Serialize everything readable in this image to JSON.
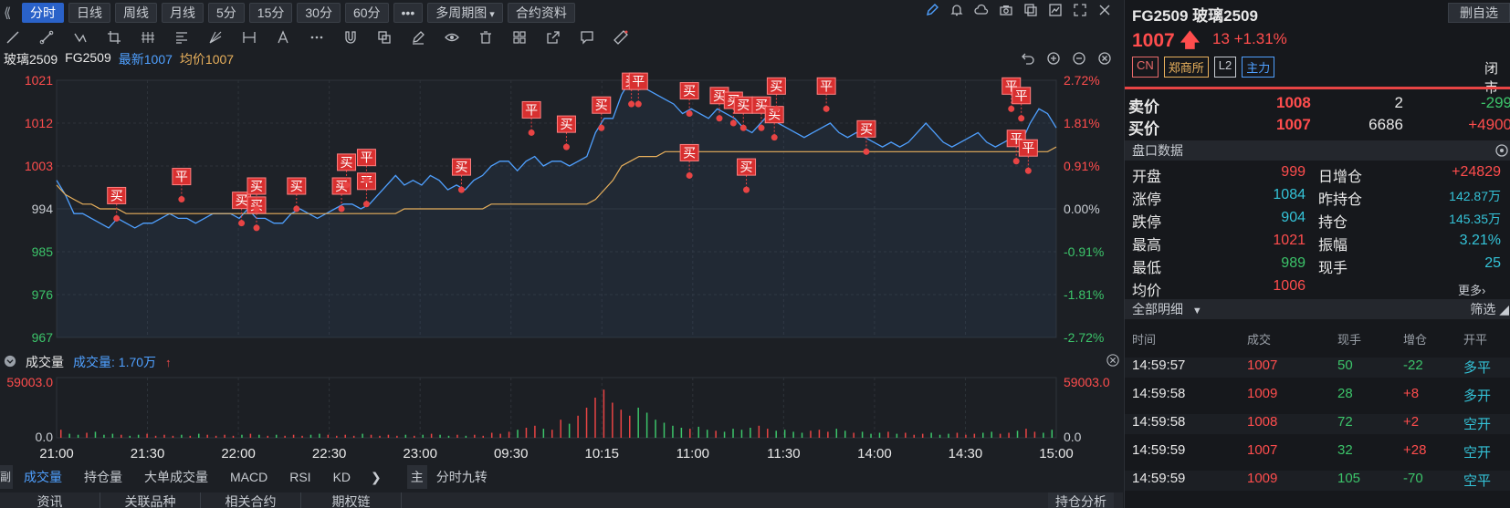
{
  "toolbar": {
    "periods": [
      "分时",
      "日线",
      "周线",
      "月线",
      "5分",
      "15分",
      "30分",
      "60分"
    ],
    "more": "•••",
    "multi": "多周期图",
    "contract": "合约资料"
  },
  "info": {
    "name": "玻璃2509",
    "code": "FG2509",
    "latest": "最新1007",
    "avg": "均价1007"
  },
  "chart_data": {
    "type": "line",
    "x_ticks": [
      "21:00",
      "21:30",
      "22:00",
      "22:30",
      "23:00",
      "09:30",
      "10:15",
      "11:00",
      "11:30",
      "14:00",
      "14:30",
      "15:00"
    ],
    "y_left_ticks": [
      "1021",
      "1012",
      "1003",
      "994",
      "985",
      "976",
      "967"
    ],
    "y_right_ticks": [
      "2.72%",
      "1.81%",
      "0.91%",
      "0.00%",
      "-0.91%",
      "-1.81%",
      "-2.72%"
    ],
    "ylim": [
      967,
      1021
    ],
    "prev_close": 994,
    "series": [
      {
        "name": "最新",
        "color": "#4fa0ff",
        "values": [
          1000,
          997,
          993,
          993,
          992,
          991,
          990,
          992,
          991,
          990,
          991,
          991,
          992,
          993,
          992,
          992,
          991,
          992,
          993,
          993,
          993,
          992,
          994,
          992,
          992,
          991,
          991,
          993,
          994,
          993,
          992,
          993,
          994,
          995,
          995,
          994,
          995,
          997,
          999,
          1001,
          999,
          1000,
          999,
          1001,
          1000,
          998,
          999,
          998,
          1000,
          1001,
          1003,
          1004,
          1004,
          1002,
          1004,
          1005,
          1003,
          1004,
          1004,
          1003,
          1004,
          1005,
          1010,
          1013,
          1013,
          1018,
          1021,
          1020,
          1019,
          1018,
          1017,
          1016,
          1014,
          1015,
          1014,
          1013,
          1015,
          1014,
          1013,
          1011,
          1010,
          1012,
          1014,
          1012,
          1011,
          1010,
          1009,
          1010,
          1011,
          1012,
          1010,
          1009,
          1010,
          1009,
          1008,
          1007,
          1008,
          1007,
          1008,
          1010,
          1012,
          1010,
          1008,
          1007,
          1008,
          1009,
          1010,
          1008,
          1007,
          1008,
          1009,
          1008,
          1012,
          1015,
          1014,
          1011
        ]
      },
      {
        "name": "均价",
        "color": "#e8b05c",
        "values": [
          999,
          997,
          996,
          995,
          995,
          994,
          994,
          994,
          993,
          993,
          993,
          993,
          993,
          993,
          993,
          993,
          993,
          993,
          993,
          993,
          993,
          993,
          993,
          993,
          993,
          993,
          993,
          993,
          993,
          993,
          993,
          993,
          993,
          993,
          993,
          993,
          993,
          993,
          993,
          993,
          994,
          994,
          994,
          994,
          994,
          994,
          994,
          994,
          994,
          994,
          995,
          995,
          995,
          995,
          995,
          995,
          995,
          995,
          995,
          995,
          995,
          995,
          996,
          998,
          1000,
          1003,
          1004,
          1005,
          1005,
          1005,
          1006,
          1006,
          1006,
          1006,
          1006,
          1006,
          1006,
          1006,
          1006,
          1006,
          1006,
          1006,
          1006,
          1006,
          1006,
          1006,
          1006,
          1006,
          1006,
          1006,
          1006,
          1006,
          1006,
          1006,
          1006,
          1006,
          1006,
          1006,
          1006,
          1006,
          1006,
          1006,
          1006,
          1006,
          1006,
          1006,
          1006,
          1006,
          1006,
          1006,
          1006,
          1006,
          1006,
          1006,
          1006,
          1007
        ]
      }
    ],
    "markers": [
      {
        "label": "买",
        "x": 0.06,
        "price": 992
      },
      {
        "label": "平",
        "x": 0.125,
        "price": 996
      },
      {
        "label": "买",
        "x": 0.185,
        "price": 991
      },
      {
        "label": "买",
        "x": 0.2,
        "price": 990
      },
      {
        "label": "买",
        "x": 0.2,
        "price": 994
      },
      {
        "label": "买",
        "x": 0.24,
        "price": 994
      },
      {
        "label": "买",
        "x": 0.285,
        "price": 994
      },
      {
        "label": "买",
        "x": 0.29,
        "price": 999
      },
      {
        "label": "平",
        "x": 0.31,
        "price": 995
      },
      {
        "label": "平",
        "x": 0.31,
        "price": 1000
      },
      {
        "label": "买",
        "x": 0.405,
        "price": 998
      },
      {
        "label": "平",
        "x": 0.475,
        "price": 1010
      },
      {
        "label": "买",
        "x": 0.51,
        "price": 1007
      },
      {
        "label": "买",
        "x": 0.545,
        "price": 1011
      },
      {
        "label": "买",
        "x": 0.575,
        "price": 1016
      },
      {
        "label": "平",
        "x": 0.582,
        "price": 1016
      },
      {
        "label": "买",
        "x": 0.633,
        "price": 1014
      },
      {
        "label": "买",
        "x": 0.633,
        "price": 1001
      },
      {
        "label": "买",
        "x": 0.663,
        "price": 1013
      },
      {
        "label": "买",
        "x": 0.677,
        "price": 1012
      },
      {
        "label": "买",
        "x": 0.687,
        "price": 1011
      },
      {
        "label": "买",
        "x": 0.69,
        "price": 998
      },
      {
        "label": "买",
        "x": 0.705,
        "price": 1011
      },
      {
        "label": "买",
        "x": 0.718,
        "price": 1009
      },
      {
        "label": "买",
        "x": 0.72,
        "price": 1015
      },
      {
        "label": "平",
        "x": 0.77,
        "price": 1015
      },
      {
        "label": "买",
        "x": 0.81,
        "price": 1006
      },
      {
        "label": "平",
        "x": 0.955,
        "price": 1015
      },
      {
        "label": "平",
        "x": 0.965,
        "price": 1013
      },
      {
        "label": "平",
        "x": 0.96,
        "price": 1004
      },
      {
        "label": "平",
        "x": 0.972,
        "price": 1002
      }
    ]
  },
  "volume": {
    "title": "成交量",
    "label": "成交量: 1.70万",
    "max_label": "59003.0",
    "zero_label": "0.0",
    "bars": [
      8,
      4,
      3,
      5,
      6,
      3,
      4,
      3,
      2,
      3,
      4,
      2,
      3,
      2,
      3,
      2,
      4,
      3,
      2,
      3,
      2,
      3,
      4,
      3,
      2,
      3,
      2,
      3,
      2,
      3,
      4,
      3,
      2,
      3,
      2,
      4,
      3,
      2,
      3,
      2,
      3,
      2,
      3,
      4,
      3,
      2,
      3,
      2,
      3,
      2,
      5,
      4,
      6,
      8,
      10,
      12,
      9,
      8,
      18,
      14,
      22,
      30,
      40,
      48,
      35,
      28,
      22,
      30,
      25,
      18,
      15,
      12,
      10,
      9,
      11,
      8,
      7,
      6,
      9,
      8,
      10,
      12,
      9,
      7,
      8,
      6,
      5,
      7,
      8,
      6,
      9,
      7,
      5,
      6,
      4,
      5,
      6,
      4,
      5,
      3,
      4,
      5,
      3,
      4,
      5,
      3,
      4,
      5,
      6,
      4,
      5,
      7,
      9,
      6,
      5,
      8
    ]
  },
  "bottom_tabs": {
    "side": "副",
    "tabs": [
      "成交量",
      "持仓量",
      "大单成交量",
      "MACD",
      "RSI",
      "KD"
    ],
    "arrow": "❯",
    "zhu": "主",
    "zhu_tab": "分时九转"
  },
  "footer_tabs": [
    "资讯",
    "关联品种",
    "相关合约",
    "期权链"
  ],
  "footer_right": "持仓分析",
  "right": {
    "name": "FG2509  玻璃2509",
    "fav": "删自选",
    "price": "1007",
    "change": "13  +1.31%",
    "tags": [
      "CN",
      "郑商所",
      "L2",
      "主力"
    ],
    "status": "闭市",
    "sell": {
      "label": "卖价",
      "price": "1008",
      "vol": "2",
      "delta": "-299"
    },
    "buy": {
      "label": "买价",
      "price": "1007",
      "vol": "6686",
      "delta": "+4900"
    },
    "book_title": "盘口数据",
    "stats_left": [
      {
        "k": "开盘",
        "v": "999"
      },
      {
        "k": "涨停",
        "v": "1084"
      },
      {
        "k": "跌停",
        "v": "904"
      },
      {
        "k": "最高",
        "v": "1021"
      },
      {
        "k": "最低",
        "v": "989"
      },
      {
        "k": "均价",
        "v": "1006"
      }
    ],
    "stats_right": [
      {
        "k": "日增仓",
        "v": "+24829"
      },
      {
        "k": "昨持仓",
        "v": "142.87万"
      },
      {
        "k": "持仓",
        "v": "145.35万"
      },
      {
        "k": "振幅",
        "v": "3.21%"
      },
      {
        "k": "现手",
        "v": "25"
      }
    ],
    "more": "更多›",
    "detail_title": "全部明细",
    "filter": "筛选",
    "detail_head": [
      "时间",
      "成交",
      "现手",
      "增仓",
      "开平"
    ],
    "detail_rows": [
      [
        "14:59:57",
        "1007",
        "50",
        "-22",
        "多平"
      ],
      [
        "14:59:58",
        "1009",
        "28",
        "+8",
        "多开"
      ],
      [
        "14:59:58",
        "1008",
        "72",
        "+2",
        "空开"
      ],
      [
        "14:59:59",
        "1007",
        "32",
        "+28",
        "空开"
      ],
      [
        "14:59:59",
        "1009",
        "105",
        "-70",
        "空平"
      ]
    ]
  }
}
